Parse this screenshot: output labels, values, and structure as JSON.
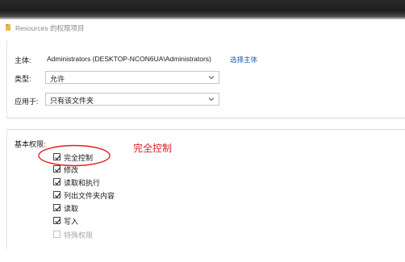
{
  "window": {
    "title": "Resources 的权限项目"
  },
  "owner": {
    "label": "主体:",
    "value": "Administrators (DESKTOP-NCON6UA\\Administrators)",
    "select_link": "选择主体"
  },
  "type": {
    "label": "类型:",
    "selected": "允许"
  },
  "applies_to": {
    "label": "应用于:",
    "selected": "只有该文件夹"
  },
  "basic_permissions": {
    "title": "基本权限:",
    "items": [
      {
        "label": "完全控制",
        "checked": true,
        "enabled": true
      },
      {
        "label": "修改",
        "checked": true,
        "enabled": true
      },
      {
        "label": "读取和执行",
        "checked": true,
        "enabled": true
      },
      {
        "label": "列出文件夹内容",
        "checked": true,
        "enabled": true
      },
      {
        "label": "读取",
        "checked": true,
        "enabled": true
      },
      {
        "label": "写入",
        "checked": true,
        "enabled": true
      },
      {
        "label": "特殊权限",
        "checked": false,
        "enabled": false
      }
    ]
  },
  "annotation": {
    "text": "完全控制",
    "color": "#e02020"
  },
  "colors": {
    "link": "#1a5fb4",
    "folder": "#e8b84a"
  },
  "icons": [
    "folder-icon",
    "chevron-down-icon",
    "checkbox-checked-icon",
    "annotation-ellipse"
  ]
}
